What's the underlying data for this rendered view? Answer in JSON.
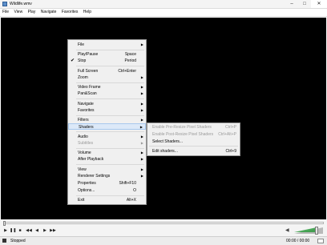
{
  "window": {
    "title": "Wildlife.wmv"
  },
  "menubar": [
    "File",
    "View",
    "Play",
    "Navigate",
    "Favorites",
    "Help"
  ],
  "context_menu": {
    "items": [
      {
        "label": "File",
        "submenu": true
      },
      {
        "label": "Play/Pause",
        "shortcut": "Space"
      },
      {
        "label": "Stop",
        "shortcut": "Period",
        "checked": true
      },
      {
        "label": "Full Screen",
        "shortcut": "Ctrl+Enter"
      },
      {
        "label": "Zoom",
        "submenu": true
      },
      {
        "label": "Video Frame",
        "submenu": true
      },
      {
        "label": "Pan&Scan",
        "submenu": true
      },
      {
        "label": "Navigate",
        "submenu": true
      },
      {
        "label": "Favorites",
        "submenu": true
      },
      {
        "label": "Filters",
        "submenu": true
      },
      {
        "label": "Shaders",
        "submenu": true,
        "highlighted": true
      },
      {
        "label": "Audio",
        "submenu": true
      },
      {
        "label": "Subtitles",
        "submenu": true,
        "disabled": true
      },
      {
        "label": "Volume",
        "submenu": true
      },
      {
        "label": "After Playback",
        "submenu": true
      },
      {
        "label": "View",
        "submenu": true
      },
      {
        "label": "Renderer Settings",
        "submenu": true
      },
      {
        "label": "Properties",
        "shortcut": "Shift+F10"
      },
      {
        "label": "Options...",
        "shortcut": "O"
      },
      {
        "label": "Exit",
        "shortcut": "Alt+X"
      }
    ]
  },
  "shaders_submenu": {
    "items": [
      {
        "label": "Enable Pre-Resize Pixel Shaders",
        "shortcut": "Ctrl+P",
        "disabled": true
      },
      {
        "label": "Enable Post-Resize Pixel Shaders",
        "shortcut": "Ctrl+Alt+P",
        "disabled": true
      },
      {
        "label": "Select Shaders..."
      },
      {
        "label": "Edit shaders...",
        "shortcut": "Ctrl+9"
      }
    ]
  },
  "playback": {
    "position_fraction": 0,
    "volume_fraction": 0.78
  },
  "controls": {
    "icons": [
      "play-icon",
      "pause-icon",
      "stop-icon",
      "skip-back-icon",
      "frame-back-icon",
      "frame-forward-icon",
      "skip-forward-icon",
      "speaker-icon"
    ],
    "glyphs": {
      "play": "▶",
      "pause": "❚❚",
      "stop": "■",
      "skip_back": "◀◀",
      "frame_back": "◀",
      "frame_forward": "▶",
      "skip_forward": "▶▶",
      "speaker": "◀"
    }
  },
  "status": {
    "state": "Stopped",
    "time": "00:00 / 00:00"
  },
  "colors": {
    "video_background": "#000000",
    "menu_background": "#f0f0f0",
    "highlight": "#dce9f8",
    "volume_fill": "#2e9a3e"
  }
}
